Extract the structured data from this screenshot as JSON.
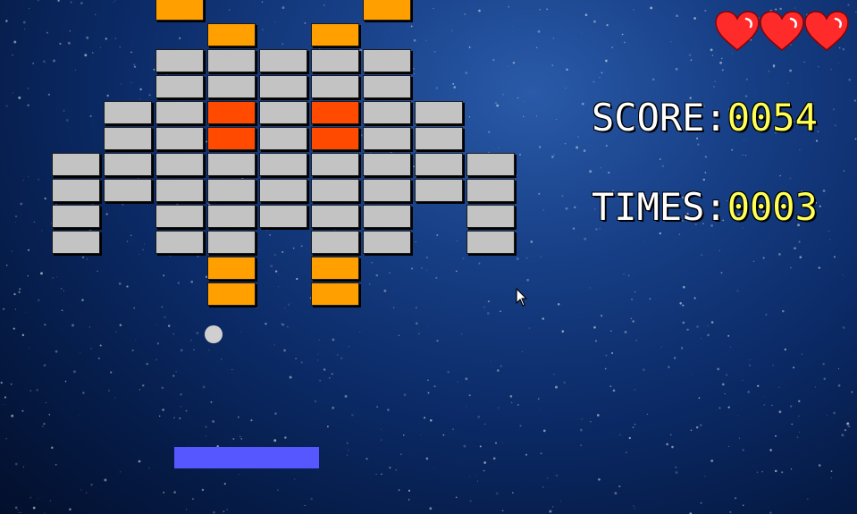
{
  "hud": {
    "score_label": "SCORE:",
    "score_value": "0054",
    "times_label": "TIMES:",
    "times_value": "0003",
    "lives": 3
  },
  "bricks": {
    "colors": {
      "gray": "#c3c3c3",
      "orange": "#ffa000",
      "red": "#ff4a00"
    },
    "grid": [
      "..O...O...",
      "...O.O....",
      "..GGGGG...",
      "..GGGGG...",
      ".GGRGRGG..",
      ".GGRGRGG..",
      "GGGGGGGGG.",
      "GGGGGGGGG.",
      "G.GGGGG.G.",
      "G.GG.GG.G.",
      "...O.O....",
      "...O.O...."
    ]
  },
  "colors": {
    "background": "#0b2a66",
    "paddle": "#5757ff",
    "ball": "#cfcfcf",
    "heart": "#ff2a2a",
    "score_value": "#ffff55"
  },
  "icons": {
    "life": "heart-icon",
    "pointer": "mouse-cursor-icon"
  }
}
